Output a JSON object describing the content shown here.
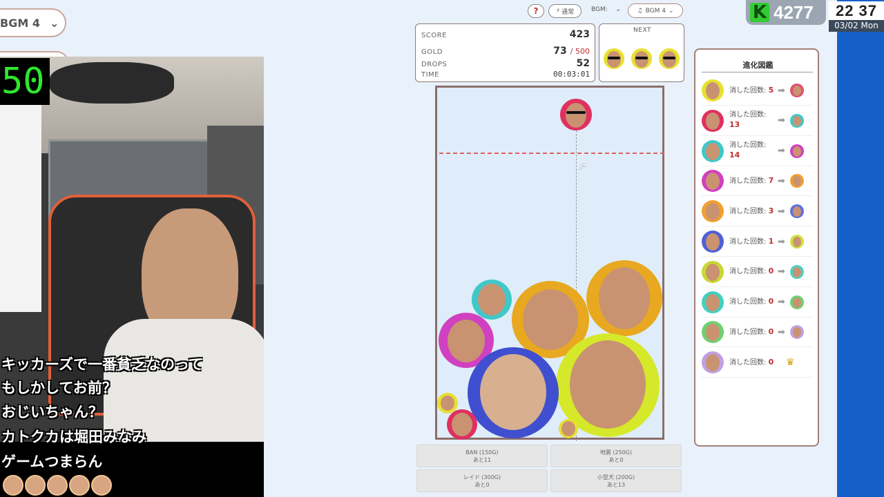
{
  "left_pill": {
    "label": "BGM 4",
    "chevron": "chevron-down-icon"
  },
  "stream": {
    "counter": "50",
    "chat_lines": [
      "キッカーズで一番貧乏なのって",
      "もしかしてお前？",
      "おじいちゃん？",
      "カトクカは堀田みなみ",
      "ゲームつまらん"
    ]
  },
  "toolbar": {
    "help_label": "?",
    "mode_label": "通常",
    "mode_icon": "lightning-icon",
    "bgm_label": "BGM:",
    "bgm_select_value": "BGM 4",
    "bgm_icon": "music-note-icon"
  },
  "stats": {
    "score_label": "SCORE",
    "score": "423",
    "gold_label": "GOLD",
    "gold": "73",
    "gold_max": "/ 500",
    "drops_label": "DROPS",
    "drops": "52",
    "time_label": "TIME",
    "time": "00:03:01"
  },
  "next": {
    "label": "NEXT"
  },
  "encyclopedia": {
    "title": "進化図鑑",
    "rows": [
      {
        "label": "消した回数:",
        "count": "5",
        "color": "#e8e030",
        "next_color": "#e05070"
      },
      {
        "label": "消した回数:",
        "count": "13",
        "color": "#e03060",
        "next_color": "#40c8c8"
      },
      {
        "label": "消した回数:",
        "count": "14",
        "color": "#40c8c8",
        "next_color": "#d040c0"
      },
      {
        "label": "消した回数:",
        "count": "7",
        "color": "#d040c0",
        "next_color": "#f0a030"
      },
      {
        "label": "消した回数:",
        "count": "3",
        "color": "#f0a030",
        "next_color": "#6070e0"
      },
      {
        "label": "消した回数:",
        "count": "1",
        "color": "#5060d8",
        "next_color": "#d0e040"
      },
      {
        "label": "消した回数:",
        "count": "0",
        "color": "#c8d830",
        "next_color": "#50d0c0"
      },
      {
        "label": "消した回数:",
        "count": "0",
        "color": "#40d0c0",
        "next_color": "#70d070"
      },
      {
        "label": "消した回数:",
        "count": "0",
        "color": "#70d070",
        "next_color": "#c0a0e0"
      },
      {
        "label": "消した回数:",
        "count": "0",
        "color": "#c0a0e0",
        "crown": "crown-icon"
      }
    ]
  },
  "items": [
    {
      "name": "BAN (150G)",
      "remaining": "あと11"
    },
    {
      "name": "地震 (250G)",
      "remaining": "あと0"
    },
    {
      "name": "レイド (300G)",
      "remaining": "あと0"
    },
    {
      "name": "小型犬 (200G)",
      "remaining": "あと13"
    }
  ],
  "overlay": {
    "points": "4277",
    "points_icon": "K",
    "clock_time": "22 37",
    "clock_date": "03/02 Mon"
  }
}
